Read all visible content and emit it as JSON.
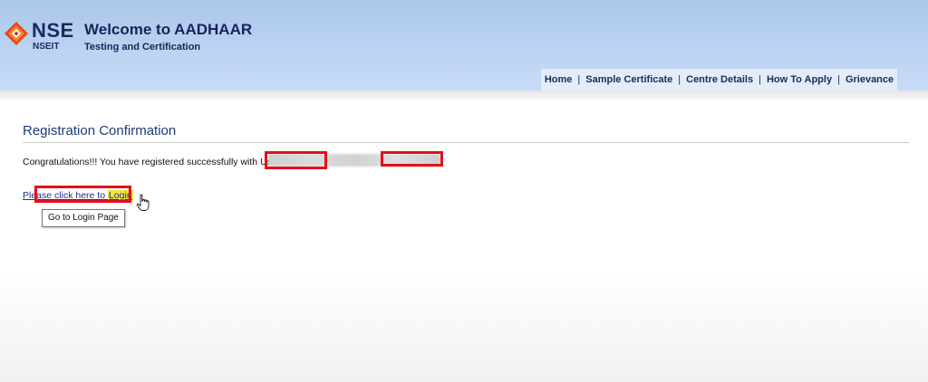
{
  "header": {
    "logo_text": "NSE",
    "logo_sub": "NSEIT",
    "title": "Welcome to AADHAAR",
    "subtitle": "Testing and Certification"
  },
  "nav": {
    "items": [
      {
        "label": "Home"
      },
      {
        "label": "Sample Certificate"
      },
      {
        "label": "Centre Details"
      },
      {
        "label": "How To Apply"
      },
      {
        "label": "Grievance"
      }
    ],
    "separator": "|"
  },
  "main": {
    "heading": "Registration Confirmation",
    "message": "Congratulations!!! You have registered successfully with User",
    "login_prefix": "Please click here to ",
    "login_link": "Login",
    "tooltip": "Go to Login Page"
  },
  "colors": {
    "header_bg": "#bcd3f2",
    "brand_navy": "#1b2a5e",
    "heading_blue": "#1f3b78",
    "link_blue": "#1f2f8e",
    "redaction_red": "#e3111a",
    "highlight_yellow": "#f0e43a"
  },
  "icons": {
    "logo": "nse-logo-icon",
    "cursor": "hand-pointer-icon"
  }
}
